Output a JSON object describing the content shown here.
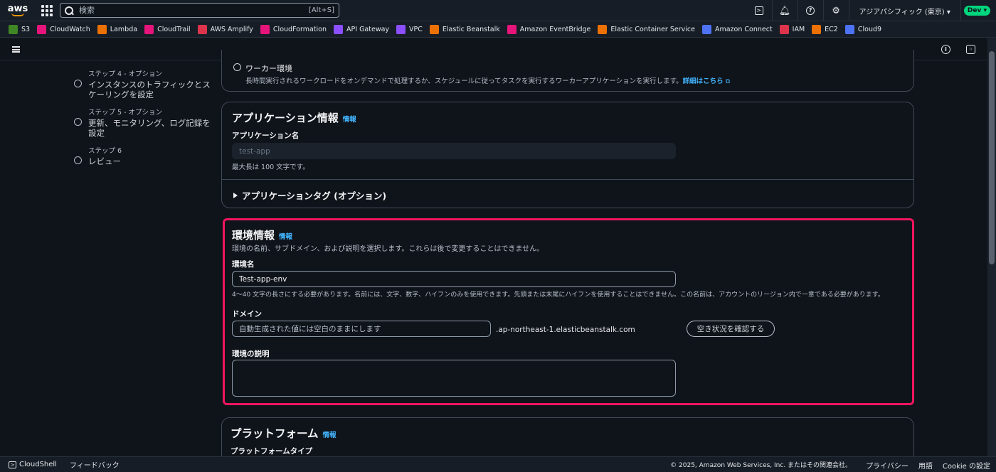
{
  "topnav": {
    "logo": "aws",
    "search_placeholder": "検索",
    "search_shortcut": "[Alt+S]",
    "region": "アジアパシフィック (東京) ▾",
    "account_badge": "Dev ▾"
  },
  "favorites": [
    {
      "label": "S3",
      "color": "#3f8624"
    },
    {
      "label": "CloudWatch",
      "color": "#e7157b"
    },
    {
      "label": "Lambda",
      "color": "#ed7100"
    },
    {
      "label": "CloudTrail",
      "color": "#e7157b"
    },
    {
      "label": "AWS Amplify",
      "color": "#dd344c"
    },
    {
      "label": "CloudFormation",
      "color": "#e7157b"
    },
    {
      "label": "API Gateway",
      "color": "#8c4fff"
    },
    {
      "label": "VPC",
      "color": "#8c4fff"
    },
    {
      "label": "Elastic Beanstalk",
      "color": "#ed7100"
    },
    {
      "label": "Amazon EventBridge",
      "color": "#e7157b"
    },
    {
      "label": "Elastic Container Service",
      "color": "#ed7100"
    },
    {
      "label": "Amazon Connect",
      "color": "#4d72f3"
    },
    {
      "label": "IAM",
      "color": "#dd344c"
    },
    {
      "label": "EC2",
      "color": "#ed7100"
    },
    {
      "label": "Cloud9",
      "color": "#4d72f3"
    }
  ],
  "steps": [
    {
      "num": "ステップ 4 - オプション",
      "title": "インスタンスのトラフィックとスケーリングを設定"
    },
    {
      "num": "ステップ 5 - オプション",
      "title": "更新、モニタリング、ログ記録を設定"
    },
    {
      "num": "ステップ 6",
      "title": "レビュー"
    }
  ],
  "worker": {
    "label": "ワーカー環境",
    "description": "長時間実行されるワークロードをオンデマンドで処理するか、スケジュールに従ってタスクを実行するワーカーアプリケーションを実行します。",
    "link": "詳細はこちら"
  },
  "app_info": {
    "title": "アプリケーション情報",
    "info": "情報",
    "name_label": "アプリケーション名",
    "name_value": "test-app",
    "name_hint": "最大長は 100 文字です。",
    "tags_label": "アプリケーションタグ (オプション)"
  },
  "env_info": {
    "title": "環境情報",
    "info": "情報",
    "description": "環境の名前、サブドメイン、および説明を選択します。これらは後で変更することはできません。",
    "env_name_label": "環境名",
    "env_name_value": "Test-app-env",
    "env_name_hint": "4〜40 文字の長さにする必要があります。名前には、文字、数字、ハイフンのみを使用できます。先頭または末尾にハイフンを使用することはできません。この名前は、アカウントのリージョン内で一意である必要があります。",
    "domain_label": "ドメイン",
    "domain_placeholder": "自動生成された値には空白のままにします",
    "domain_suffix": ".ap-northeast-1.elasticbeanstalk.com",
    "check_button": "空き状況を確認する",
    "env_desc_label": "環境の説明"
  },
  "platform": {
    "title": "プラットフォーム",
    "info": "情報",
    "type_label": "プラットフォームタイプ"
  },
  "footer": {
    "cloudshell": "CloudShell",
    "feedback": "フィードバック",
    "copyright": "© 2025, Amazon Web Services, Inc. またはその関連会社。",
    "privacy": "プライバシー",
    "terms": "用語",
    "cookie": "Cookie の設定"
  }
}
